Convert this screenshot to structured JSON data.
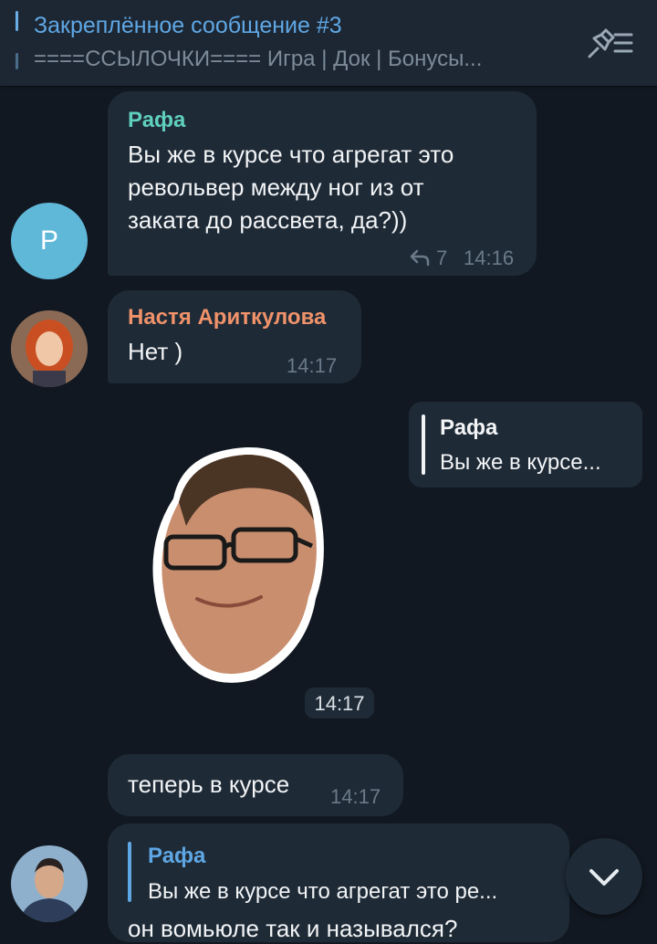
{
  "pinned": {
    "title": "Закреплённое сообщение #3",
    "text": "====ССЫЛОЧКИ==== Игра | Док | Бонусы...",
    "icon": "unpin-list-icon"
  },
  "messages": [
    {
      "sender": "Рафа",
      "sender_color": "#5fd0bd",
      "avatar_letter": "P",
      "lines": [
        "Вы же в курсе что агрегат это",
        "револьвер между ног из от",
        "заката до рассвета, да?))"
      ],
      "replies": "7",
      "time": "14:16"
    },
    {
      "sender": "Настя Ариткулова",
      "sender_color": "#f0926a",
      "text": "Нет )",
      "time": "14:17"
    },
    {
      "quote_author": "Рафа",
      "quote_text": "Вы же в курсе...",
      "sticker": "face-sticker",
      "time": "14:17"
    },
    {
      "text": "теперь в курсе",
      "time": "14:17"
    },
    {
      "quote_author": "Рафа",
      "quote_text": "Вы же в курсе что агрегат это ре...",
      "text": "он вомьюле так и назывался?"
    }
  ],
  "scroll_button": {
    "icon": "chevron-down-icon"
  },
  "colors": {
    "background": "#111821",
    "bubble": "#1e2a36",
    "accent": "#5fa7e4"
  }
}
